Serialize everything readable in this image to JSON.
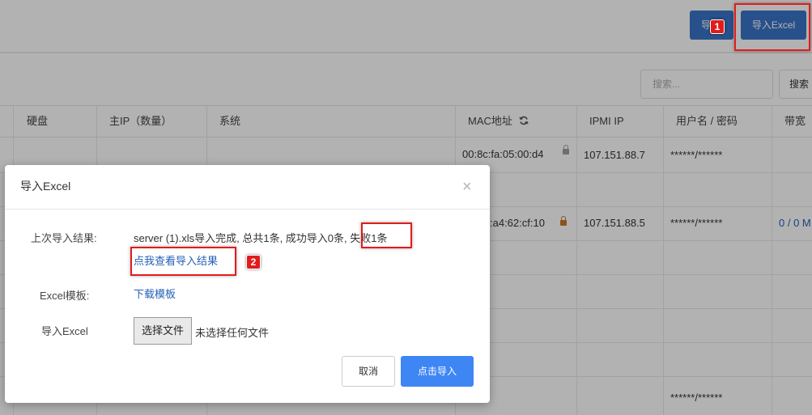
{
  "toolbar": {
    "import_small_label": "导",
    "import_excel_label": "导入Excel",
    "marker_1": "1"
  },
  "search": {
    "placeholder": "搜索...",
    "button_label": "搜索"
  },
  "table": {
    "headers": {
      "disk": "硬盘",
      "main_ip": "主IP（数量）",
      "system": "系统",
      "mac": "MAC地址",
      "ipmi": "IPMI IP",
      "credentials": "用户名 / 密码",
      "bandwidth": "带宽"
    },
    "rows": [
      {
        "mac": "00:8c:fa:05:00:d4",
        "ipmi": "107.151.88.7",
        "credentials": "******/******",
        "bandwidth": ""
      },
      {
        "mac": "",
        "ipmi": "",
        "credentials": "",
        "bandwidth": ""
      },
      {
        "mac": ":a4:62:cf:10",
        "ipmi": "107.151.88.5",
        "credentials": "******/******",
        "bandwidth": "0 / 0 M"
      },
      {
        "mac": "",
        "ipmi": "",
        "credentials": "******/******",
        "bandwidth": ""
      }
    ]
  },
  "modal": {
    "title": "导入Excel",
    "close_glyph": "×",
    "last_result_label": "上次导入结果:",
    "last_result_text": "server (1).xls导入完成, 总共1条, 成功导入0条, ",
    "last_result_failed": "失败1条",
    "view_result_link": "点我查看导入结果",
    "marker_2": "2",
    "template_label": "Excel模板:",
    "download_template_link": "下载模板",
    "import_label": "导入Excel",
    "choose_file_label": "选择文件",
    "no_file_text": "未选择任何文件",
    "cancel_label": "取消",
    "submit_label": "点击导入"
  },
  "colors": {
    "primary_blue": "#3a73c8",
    "submit_blue": "#3f86f5",
    "link_blue": "#2561b7",
    "highlight_red": "#e21b1b"
  }
}
